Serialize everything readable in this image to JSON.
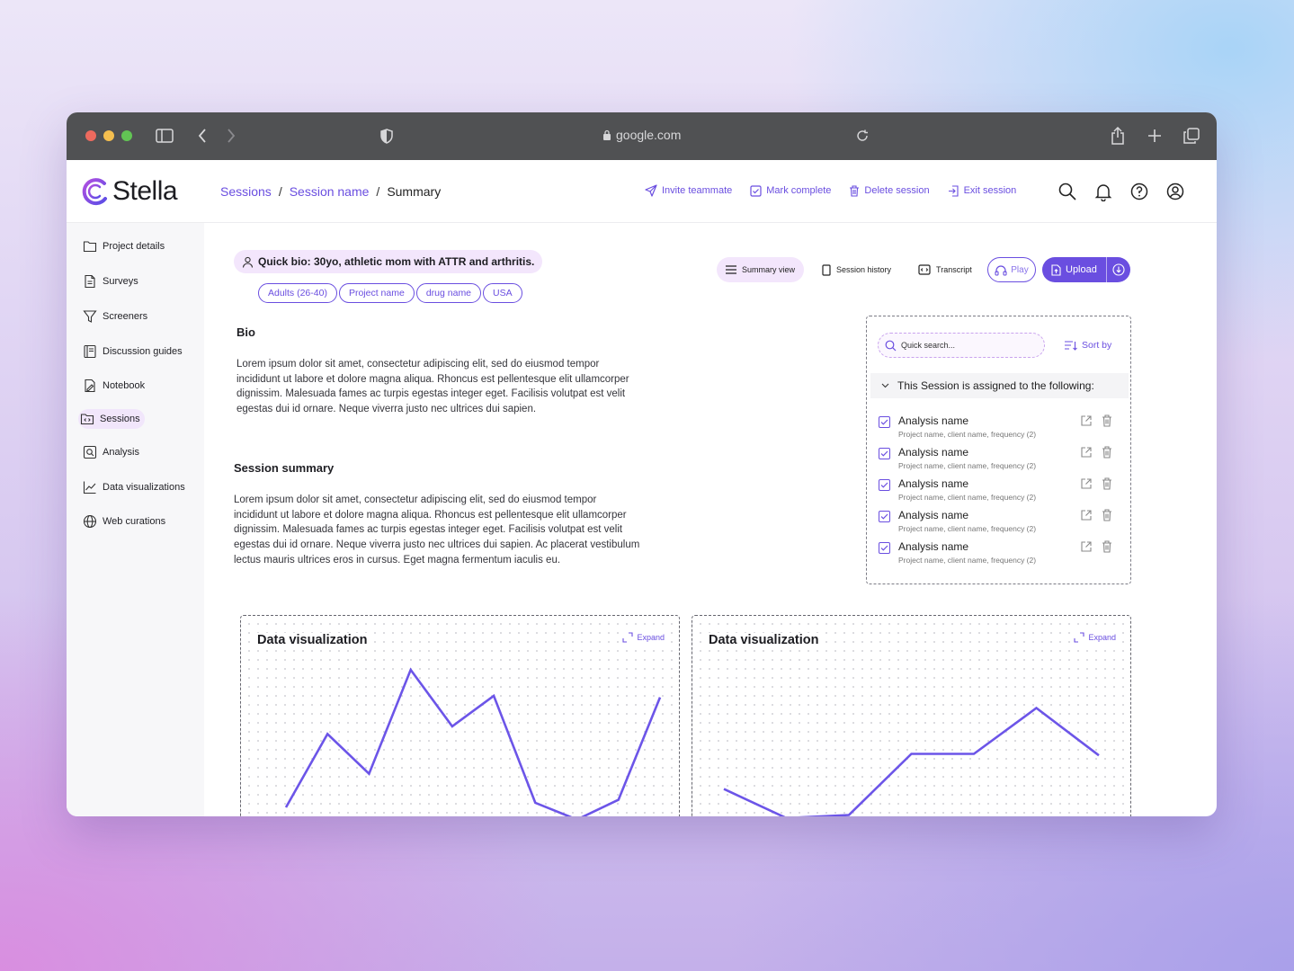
{
  "browser": {
    "url": "google.com",
    "colors": {
      "red": "#ed6a5e",
      "yellow": "#f5bf4f",
      "green": "#62c554"
    }
  },
  "app": {
    "logo": "Stella",
    "breadcrumb": {
      "sessions": "Sessions",
      "sep": "/",
      "session": "Session name",
      "current": "Summary"
    },
    "actions": {
      "invite": "Invite teammate",
      "complete": "Mark complete",
      "delete": "Delete session",
      "exit": "Exit session"
    },
    "accent": "#6a4ee0"
  },
  "sidebar": {
    "items": [
      {
        "label": "Project details",
        "icon": "folder-icon"
      },
      {
        "label": "Surveys",
        "icon": "document-icon"
      },
      {
        "label": "Screeners",
        "icon": "filter-icon"
      },
      {
        "label": "Discussion guides",
        "icon": "guide-icon"
      },
      {
        "label": "Notebook",
        "icon": "notebook-icon"
      },
      {
        "label": "Sessions",
        "icon": "sessions-icon",
        "active": true
      },
      {
        "label": "Analysis",
        "icon": "analysis-icon"
      },
      {
        "label": "Data visualizations",
        "icon": "chart-icon"
      },
      {
        "label": "Web curations",
        "icon": "globe-icon"
      }
    ]
  },
  "profile": {
    "quick_bio": "Quick bio: 30yo, athletic mom with ATTR and arthritis.",
    "tags": [
      "Adults (26-40)",
      "Project name",
      "drug name",
      "USA"
    ]
  },
  "bio": {
    "heading": "Bio",
    "text": "Lorem ipsum dolor sit amet, consectetur adipiscing elit, sed do eiusmod tempor incididunt ut labore et dolore magna aliqua. Rhoncus est pellentesque elit ullamcorper dignissim. Malesuada fames ac turpis egestas integer eget. Facilisis volutpat est velit egestas dui id ornare. Neque viverra justo nec ultrices dui sapien."
  },
  "summary": {
    "heading": "Session summary",
    "text": "Lorem ipsum dolor sit amet, consectetur adipiscing elit, sed do eiusmod tempor incididunt ut labore et dolore magna aliqua. Rhoncus est pellentesque elit ullamcorper dignissim. Malesuada fames ac turpis egestas integer eget. Facilisis volutpat est velit egestas dui id ornare. Neque viverra justo nec ultrices dui sapien. Ac placerat vestibulum lectus mauris ultrices eros in cursus. Eget magna fermentum iaculis eu."
  },
  "views": {
    "summary": "Summary view",
    "history": "Session history",
    "transcript": "Transcript",
    "play": "Play",
    "upload": "Upload"
  },
  "assignments": {
    "search_placeholder": "Quick search...",
    "sort": "Sort by",
    "heading": "This Session is assigned to the following:",
    "items": [
      {
        "name": "Analysis name",
        "detail": "Project name, client name, frequency (2)"
      },
      {
        "name": "Analysis name",
        "detail": "Project name, client name, frequency (2)"
      },
      {
        "name": "Analysis name",
        "detail": "Project name, client name, frequency (2)"
      },
      {
        "name": "Analysis name",
        "detail": "Project name, client name, frequency (2)"
      },
      {
        "name": "Analysis name",
        "detail": "Project name, client name, frequency (2)"
      }
    ]
  },
  "charts": [
    {
      "title": "Data visualization",
      "expand": "Expand"
    },
    {
      "title": "Data visualization",
      "expand": "Expand"
    }
  ],
  "chart_data": [
    {
      "type": "line",
      "title": "Data visualization",
      "x": [
        0,
        1,
        2,
        3,
        4,
        5,
        6,
        7,
        8,
        9
      ],
      "series": [
        {
          "values": [
            10,
            58,
            32,
            100,
            63,
            83,
            13,
            2,
            15,
            82
          ]
        }
      ],
      "ylim": [
        0,
        100
      ],
      "grid": "dotted",
      "color": "#6c55e8"
    },
    {
      "type": "line",
      "title": "Data visualization",
      "x": [
        0,
        1,
        2,
        3,
        4,
        5,
        6
      ],
      "series": [
        {
          "values": [
            22,
            3,
            5,
            45,
            45,
            75,
            44
          ]
        }
      ],
      "ylim": [
        0,
        100
      ],
      "grid": "dotted",
      "color": "#6c55e8"
    }
  ]
}
